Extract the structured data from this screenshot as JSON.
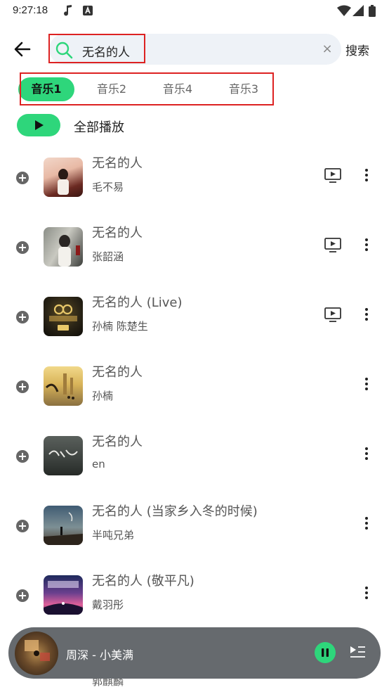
{
  "status": {
    "time": "9:27:18"
  },
  "search": {
    "query": "无名的人",
    "button_label": "搜索",
    "clear_glyph": "×"
  },
  "tabs": [
    {
      "label": "音乐1",
      "active": true
    },
    {
      "label": "音乐2",
      "active": false
    },
    {
      "label": "音乐4",
      "active": false
    },
    {
      "label": "音乐3",
      "active": false
    }
  ],
  "play_all": {
    "label": "全部播放"
  },
  "songs": [
    {
      "title": "无名的人",
      "artist": "毛不易",
      "has_mv": true
    },
    {
      "title": "无名的人",
      "artist": "张韶涵",
      "has_mv": true
    },
    {
      "title": "无名的人 (Live)",
      "artist": "孙楠 陈楚生",
      "has_mv": true
    },
    {
      "title": "无名的人",
      "artist": "孙楠",
      "has_mv": false
    },
    {
      "title": "无名的人",
      "artist": "en",
      "has_mv": false
    },
    {
      "title": "无名的人 (当家乡入冬的时候)",
      "artist": "半吨兄弟",
      "has_mv": false
    },
    {
      "title": "无名的人 (敬平凡)",
      "artist": "戴羽彤",
      "has_mv": false
    }
  ],
  "peek_song": {
    "artist": "郭麒麟"
  },
  "player": {
    "now_playing": "周深 - 小美满",
    "state": "playing"
  },
  "colors": {
    "accent": "#2ed67b",
    "highlight_box": "#dd2222",
    "player_bg": "#666a6e"
  },
  "icons": [
    "back-arrow-icon",
    "search-icon",
    "clear-icon",
    "play-icon",
    "add-circle-icon",
    "mv-icon",
    "more-vertical-icon",
    "pause-icon",
    "queue-icon",
    "music-note-icon",
    "wifi-icon",
    "signal-icon",
    "battery-icon"
  ]
}
